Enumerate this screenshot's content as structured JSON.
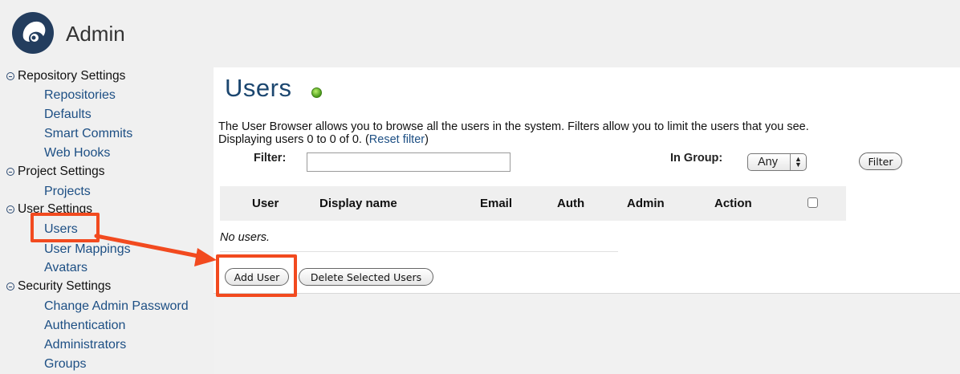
{
  "app": {
    "title": "Admin"
  },
  "sidebar": {
    "sections": [
      {
        "label": "Repository Settings",
        "items": [
          "Repositories",
          "Defaults",
          "Smart Commits",
          "Web Hooks"
        ]
      },
      {
        "label": "Project Settings",
        "items": [
          "Projects"
        ]
      },
      {
        "label": "User Settings",
        "items": [
          "Users",
          "User Mappings",
          "Avatars"
        ]
      },
      {
        "label": "Security Settings",
        "items": [
          "Change Admin Password",
          "Authentication",
          "Administrators",
          "Groups"
        ]
      }
    ]
  },
  "main": {
    "title": "Users",
    "description": "The User Browser allows you to browse all the users in the system. Filters allow you to limit the users that you see.",
    "displaying": "Displaying users 0 to 0 of 0. (",
    "reset_filter": "Reset filter",
    "displaying_close": ")",
    "filter_label": "Filter:",
    "filter_value": "",
    "group_label": "In Group:",
    "group_value": "Any",
    "filter_button": "Filter",
    "table": {
      "headers": [
        "User",
        "Display name",
        "Email",
        "Auth",
        "Admin",
        "Action"
      ],
      "empty_text": "No users."
    },
    "add_user_button": "Add User",
    "delete_button": "Delete Selected Users"
  },
  "colors": {
    "accent": "#1b466f",
    "link": "#1d4f84",
    "highlight": "#f24a1f"
  }
}
